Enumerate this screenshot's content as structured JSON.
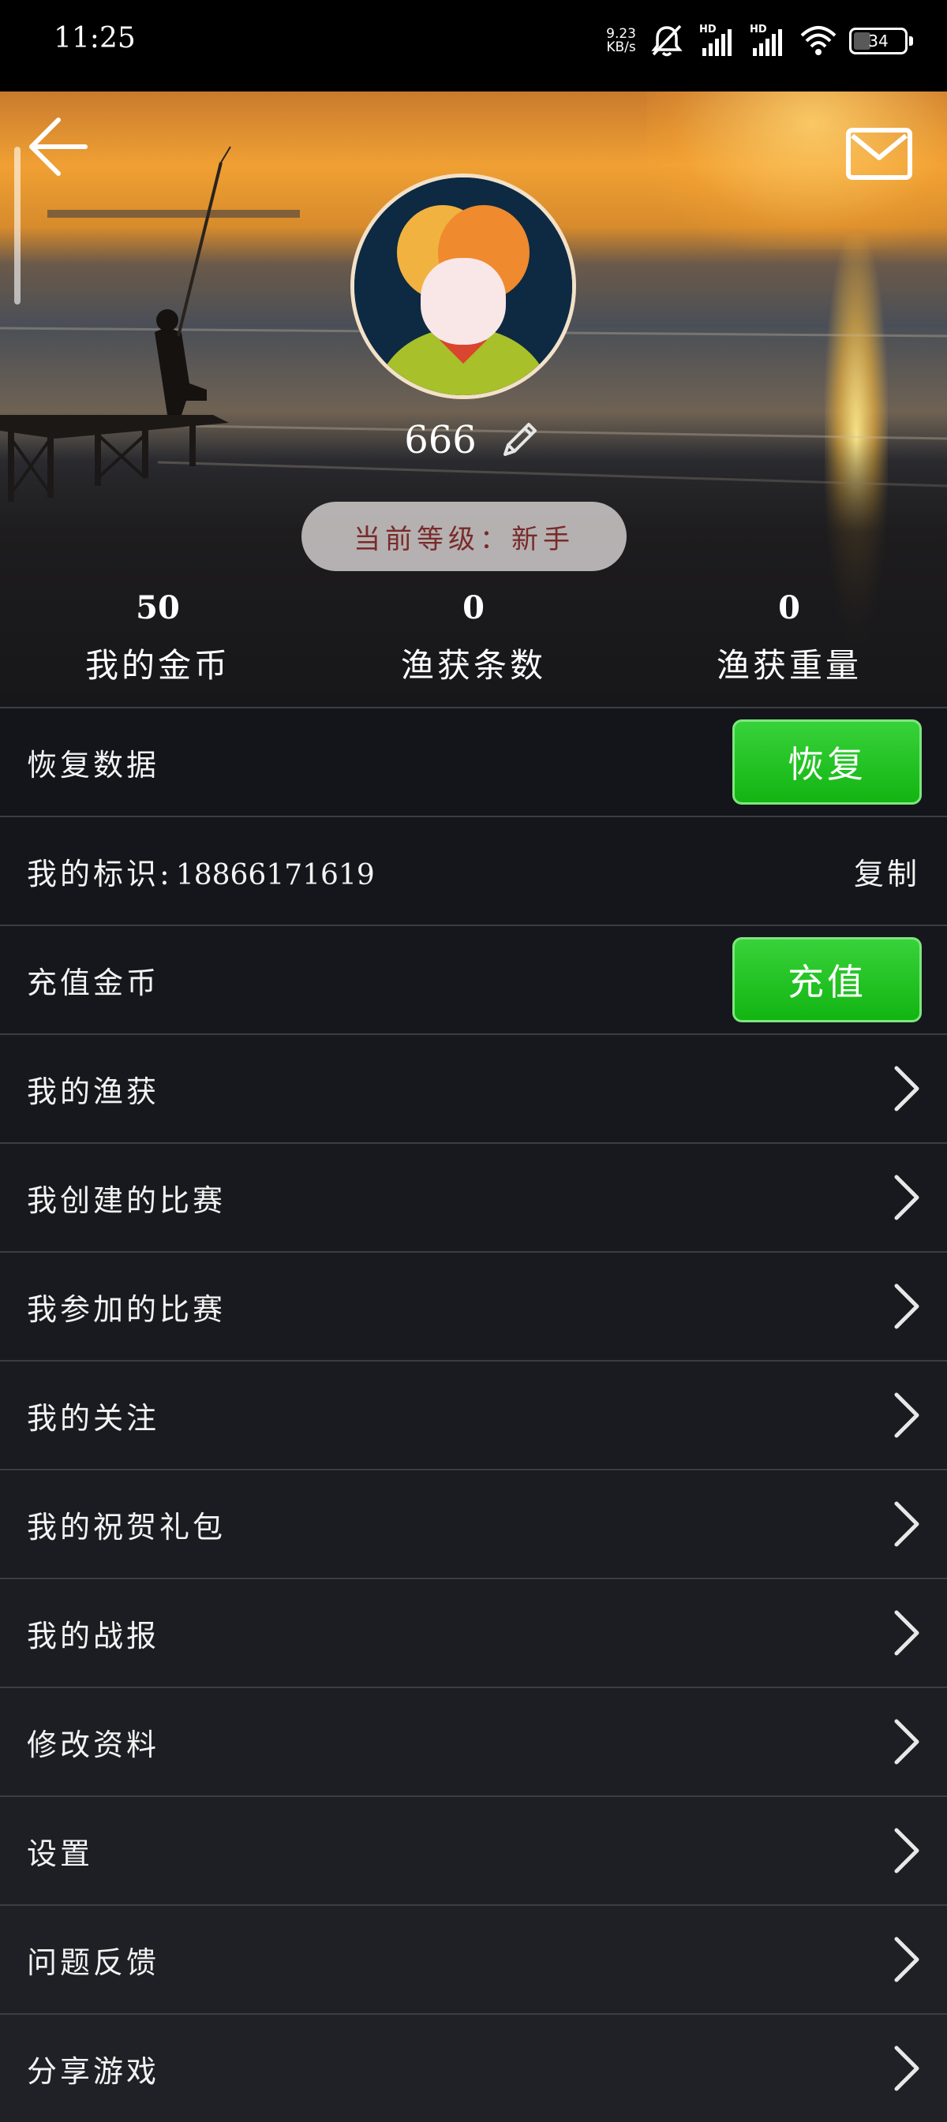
{
  "status_bar": {
    "time": "11:25",
    "net_speed_value": "9.23",
    "net_speed_unit": "KB/s",
    "battery": "34",
    "battery_level": 0.34,
    "icons": [
      "mute-bell-icon",
      "hd-signal-icon",
      "hd-signal-icon",
      "wifi-icon",
      "battery-icon"
    ]
  },
  "header": {
    "nickname": "666",
    "level": "当前等级：新手",
    "stats": [
      {
        "value": "50",
        "label": "我的金币"
      },
      {
        "value": "0",
        "label": "渔获条数"
      },
      {
        "value": "0",
        "label": "渔获重量"
      }
    ]
  },
  "rows": {
    "restore": {
      "label": "恢复数据",
      "button": "恢复"
    },
    "identity": {
      "label": "我的标识:",
      "value": "18866171619",
      "action": "复制"
    },
    "recharge": {
      "label": "充值金币",
      "button": "充值"
    },
    "menu": [
      {
        "label": "我的渔获"
      },
      {
        "label": "我创建的比赛"
      },
      {
        "label": "我参加的比赛"
      },
      {
        "label": "我的关注"
      },
      {
        "label": "我的祝贺礼包"
      },
      {
        "label": "我的战报"
      },
      {
        "label": "修改资料"
      },
      {
        "label": "设置"
      },
      {
        "label": "问题反馈"
      },
      {
        "label": "分享游戏"
      }
    ]
  },
  "colors": {
    "accent_green": "#1fc21f",
    "background": "#1d1f24",
    "level_text": "#7a2a2a"
  }
}
